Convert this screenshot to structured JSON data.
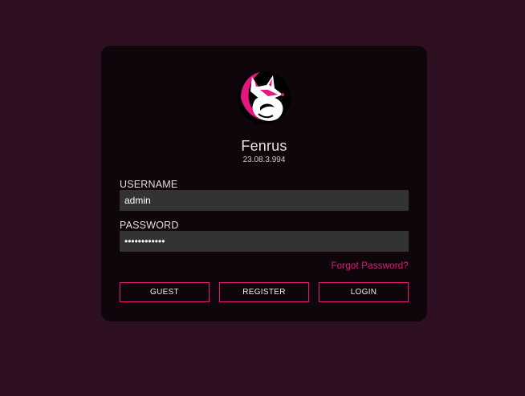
{
  "app": {
    "name": "Fenrus",
    "version": "23.08.3.994",
    "logo_icon": "fox-logo-icon"
  },
  "login_form": {
    "username_label": "USERNAME",
    "username_value": "admin",
    "password_label": "PASSWORD",
    "password_value": "••••••••••••",
    "forgot_password_label": "Forgot Password?"
  },
  "buttons": {
    "guest_label": "GUEST",
    "register_label": "REGISTER",
    "login_label": "LOGIN"
  },
  "colors": {
    "page_background": "#2f0f22",
    "card_background": "#0f060c",
    "accent": "#e5167d",
    "input_background": "#333333"
  }
}
